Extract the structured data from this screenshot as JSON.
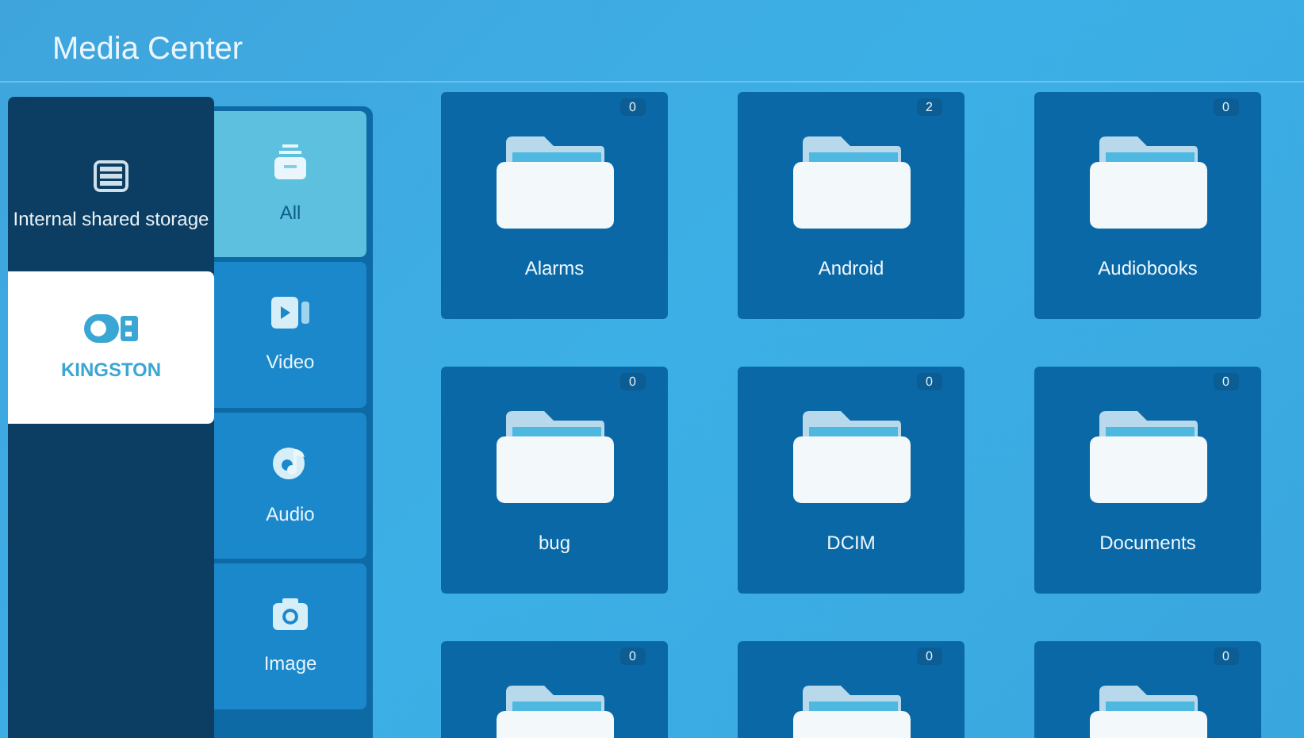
{
  "window": {
    "title": "Media Center"
  },
  "storages": [
    {
      "kind": "internal",
      "label": "Internal shared storage",
      "selected": false
    },
    {
      "kind": "usb",
      "label": "KINGSTON",
      "selected": true
    }
  ],
  "categories": [
    {
      "kind": "all",
      "label": "All",
      "selected": true
    },
    {
      "kind": "video",
      "label": "Video",
      "selected": false
    },
    {
      "kind": "audio",
      "label": "Audio",
      "selected": false
    },
    {
      "kind": "image",
      "label": "Image",
      "selected": false
    }
  ],
  "folders": [
    {
      "name": "Alarms",
      "count": "0"
    },
    {
      "name": "Android",
      "count": "2"
    },
    {
      "name": "Audiobooks",
      "count": "0"
    },
    {
      "name": "bug",
      "count": "0"
    },
    {
      "name": "DCIM",
      "count": "0"
    },
    {
      "name": "Documents",
      "count": "0"
    },
    {
      "count": "0"
    },
    {
      "count": "0"
    },
    {
      "count": "0"
    }
  ]
}
